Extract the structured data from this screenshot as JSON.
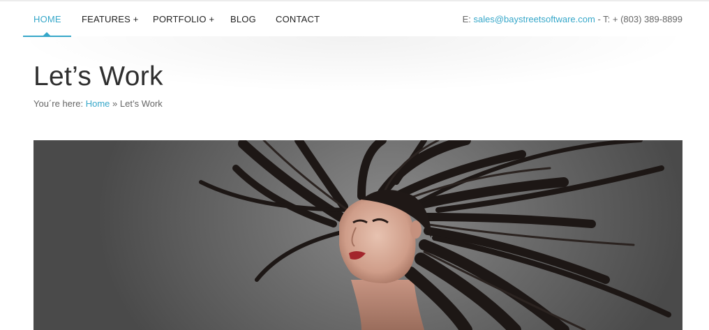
{
  "nav": {
    "items": [
      {
        "label": "HOME"
      },
      {
        "label": "FEATURES +"
      },
      {
        "label": "PORTFOLIO +"
      },
      {
        "label": "BLOG"
      },
      {
        "label": "CONTACT"
      }
    ],
    "active_index": 0,
    "contact": {
      "email_prefix": "E:",
      "email": "sales@baystreetsoftware.com",
      "phone_prefix": "- T: +",
      "phone": "(803) 389-8899"
    }
  },
  "page": {
    "title": "Let’s Work",
    "breadcrumb": {
      "prefix": "You´re here:",
      "home": "Home",
      "separator": "»",
      "current": "Let’s Work"
    }
  },
  "colors": {
    "accent": "#36a7c9",
    "text": "#2f2f2f",
    "muted": "#666666"
  },
  "hero": {
    "icon": "photo-woman-flowing-hair"
  }
}
